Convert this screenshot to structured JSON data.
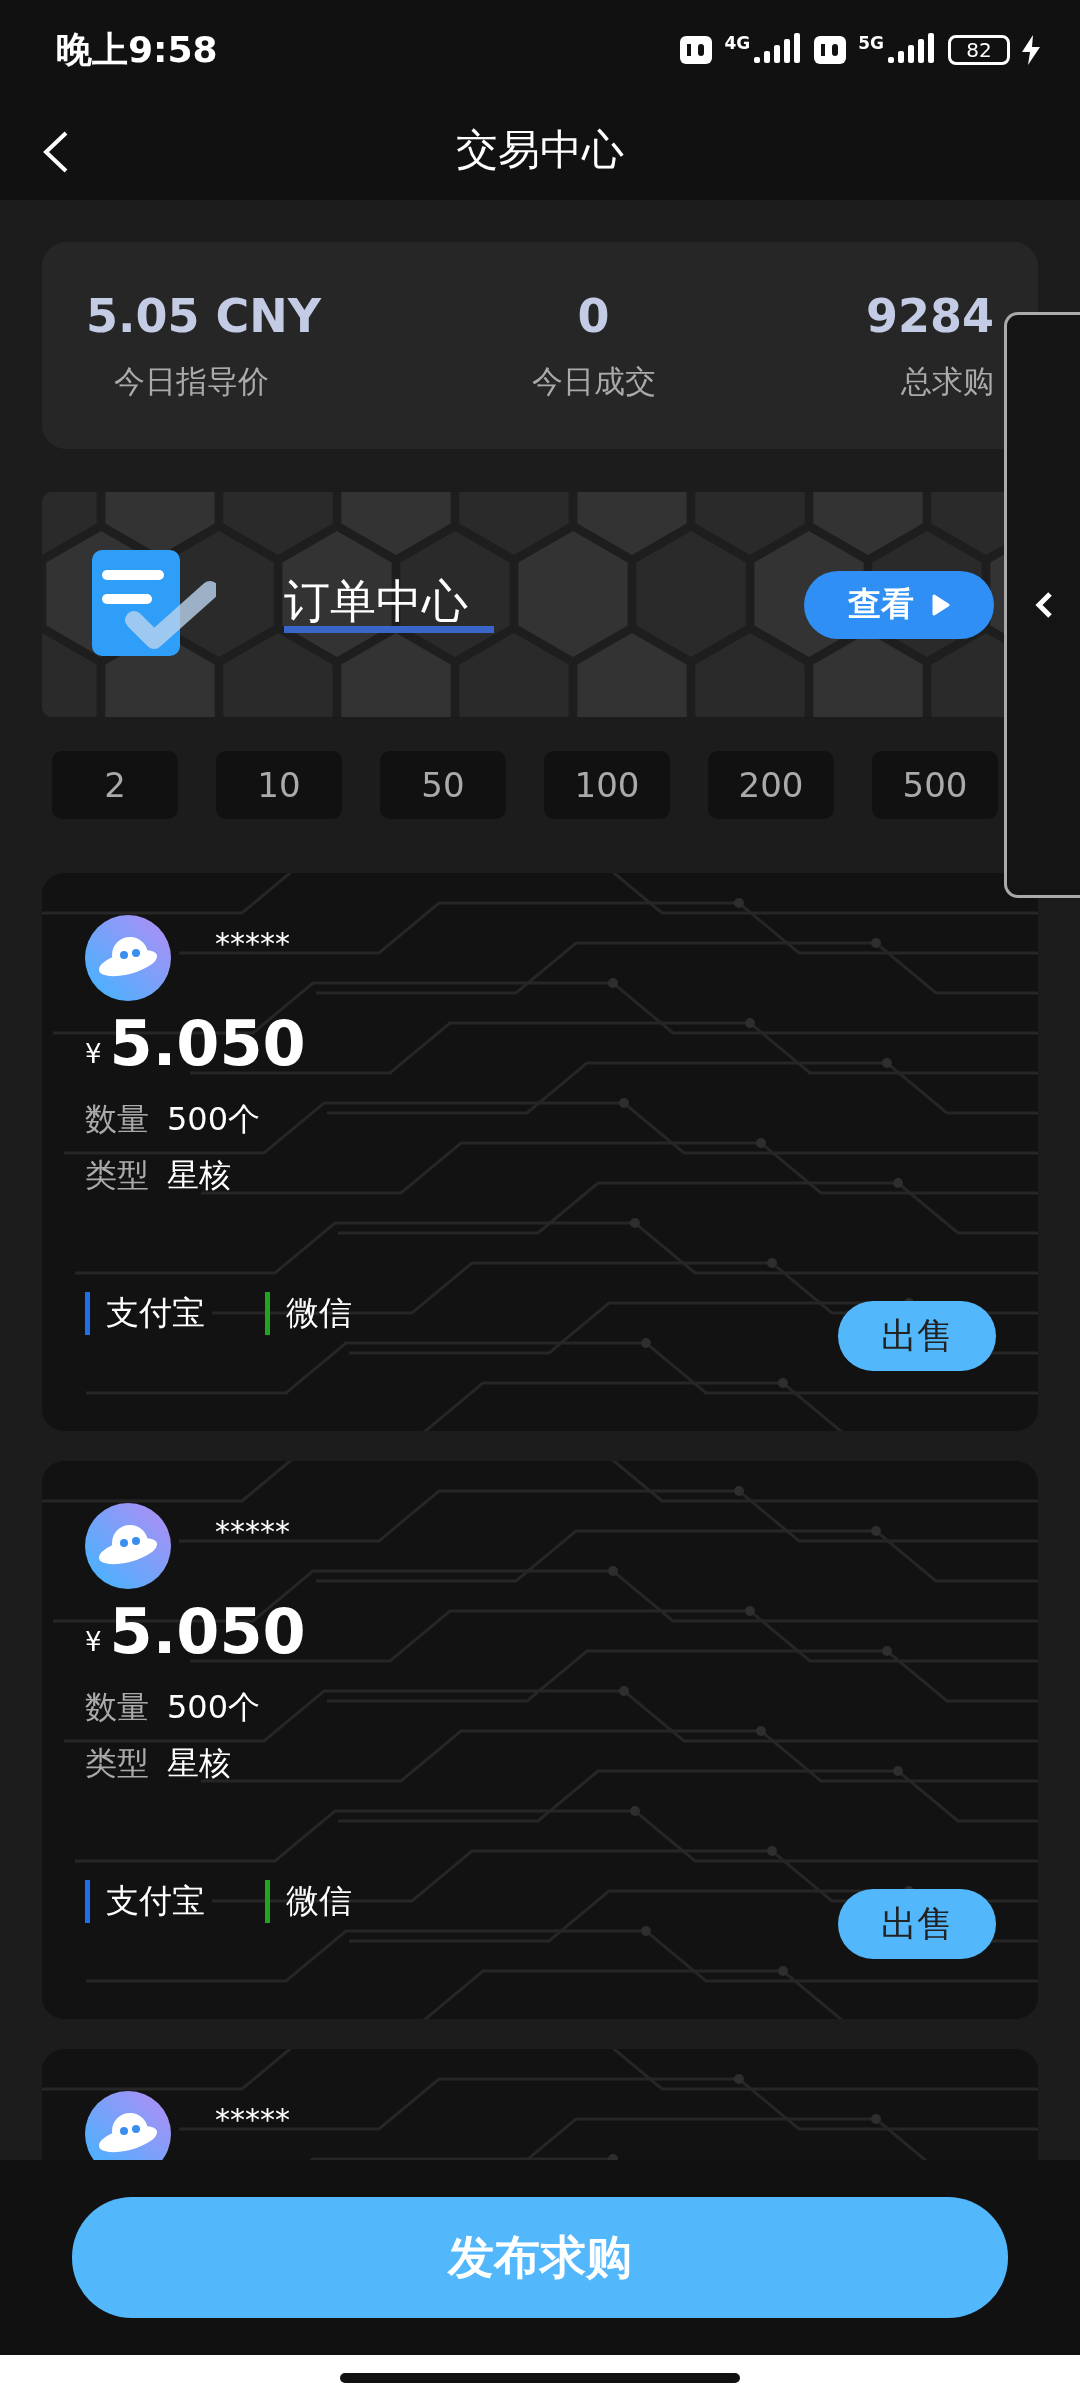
{
  "status_bar": {
    "time": "晚上9:58",
    "network_1": "4G",
    "network_2": "5G",
    "battery": "82"
  },
  "header": {
    "title": "交易中心"
  },
  "stats": [
    {
      "value": "5.05 CNY",
      "label": "今日指导价"
    },
    {
      "value": "0",
      "label": "今日成交"
    },
    {
      "value": "9284",
      "label": "总求购"
    }
  ],
  "banner": {
    "title": "订单中心",
    "button": "查看"
  },
  "amount_chips": [
    "2",
    "10",
    "50",
    "100",
    "200",
    "500"
  ],
  "orders": [
    {
      "name": "*****",
      "currency": "¥",
      "price": "5.050",
      "quantity_label": "数量",
      "quantity": "500个",
      "type_label": "类型",
      "type": "星核",
      "payments": [
        {
          "label": "支付宝",
          "color": "#1f6fe8"
        },
        {
          "label": "微信",
          "color": "#1fa51f"
        }
      ],
      "action": "出售"
    },
    {
      "name": "*****",
      "currency": "¥",
      "price": "5.050",
      "quantity_label": "数量",
      "quantity": "500个",
      "type_label": "类型",
      "type": "星核",
      "payments": [
        {
          "label": "支付宝",
          "color": "#1f6fe8"
        },
        {
          "label": "微信",
          "color": "#1fa51f"
        }
      ],
      "action": "出售"
    },
    {
      "name": "*****"
    }
  ],
  "bottom_button": "发布求购"
}
